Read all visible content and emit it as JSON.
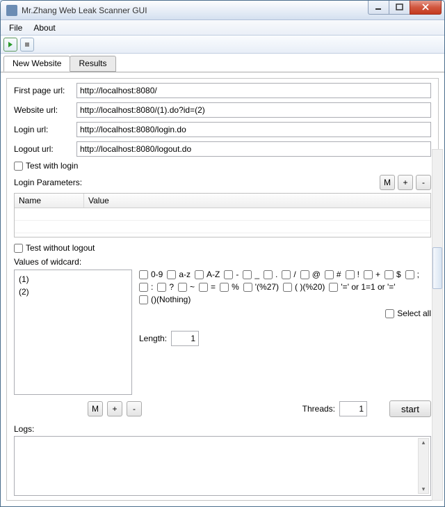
{
  "window": {
    "title": "Mr.Zhang Web Leak Scanner GUI"
  },
  "menu": {
    "file": "File",
    "about": "About"
  },
  "tabs": {
    "new": "New Website",
    "results": "Results"
  },
  "form": {
    "first_lbl": "First page url:",
    "first_val": "http://localhost:8080/",
    "web_lbl": "Website url:",
    "web_val": "http://localhost:8080/(1).do?id=(2)",
    "login_lbl": "Login url:",
    "login_val": "http://localhost:8080/login.do",
    "logout_lbl": "Logout url:",
    "logout_val": "http://localhost:8080/logout.do",
    "test_login": "Test with login",
    "login_params": "Login Parameters:",
    "name_h": "Name",
    "value_h": "Value",
    "test_logout": "Test without logout",
    "wildcard_lbl": "Values of widcard:",
    "wc_items": [
      "(1)",
      "(2)"
    ],
    "checks": [
      "0-9",
      "a-z",
      "A-Z",
      "-",
      "_",
      ".",
      "/",
      "@",
      "#",
      "!",
      "+",
      "$",
      ";",
      ":",
      "?",
      "~",
      "=",
      "%",
      "'(%27)",
      "( )(%20)",
      "'=' or 1=1 or '='",
      "()(Nothing)"
    ],
    "select_all": "Select all",
    "length_lbl": "Length:",
    "length_val": "1",
    "threads_lbl": "Threads:",
    "threads_val": "1",
    "m_btn": "M",
    "plus_btn": "+",
    "minus_btn": "-",
    "start": "start",
    "logs_lbl": "Logs:"
  }
}
